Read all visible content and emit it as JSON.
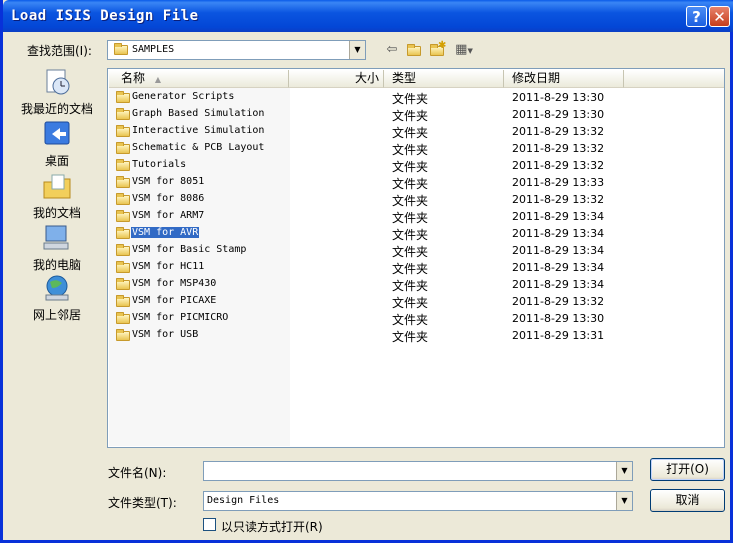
{
  "window": {
    "title": "Load ISIS Design File",
    "help_label": "?",
    "close_label": "✕"
  },
  "lookin": {
    "label": "查找范围(I):",
    "value": "SAMPLES"
  },
  "toolbar": {
    "back_icon": "back-arrow-icon",
    "up_icon": "folder-up-icon",
    "new_folder_icon": "new-folder-icon",
    "views_icon": "views-menu-icon"
  },
  "places": [
    {
      "label": "我最近的文档",
      "icon": "recent-documents-icon"
    },
    {
      "label": "桌面",
      "icon": "desktop-icon"
    },
    {
      "label": "我的文档",
      "icon": "my-documents-icon"
    },
    {
      "label": "我的电脑",
      "icon": "my-computer-icon"
    },
    {
      "label": "网上邻居",
      "icon": "network-places-icon"
    }
  ],
  "columns": {
    "name": "名称",
    "size": "大小",
    "type": "类型",
    "modified": "修改日期"
  },
  "files": [
    {
      "name": "Generator Scripts",
      "type": "文件夹",
      "modified": "2011-8-29 13:30"
    },
    {
      "name": "Graph Based Simulation",
      "type": "文件夹",
      "modified": "2011-8-29 13:30"
    },
    {
      "name": "Interactive Simulation",
      "type": "文件夹",
      "modified": "2011-8-29 13:32"
    },
    {
      "name": "Schematic & PCB Layout",
      "type": "文件夹",
      "modified": "2011-8-29 13:32"
    },
    {
      "name": "Tutorials",
      "type": "文件夹",
      "modified": "2011-8-29 13:32"
    },
    {
      "name": "VSM for 8051",
      "type": "文件夹",
      "modified": "2011-8-29 13:33"
    },
    {
      "name": "VSM for 8086",
      "type": "文件夹",
      "modified": "2011-8-29 13:32"
    },
    {
      "name": "VSM for ARM7",
      "type": "文件夹",
      "modified": "2011-8-29 13:34"
    },
    {
      "name": "VSM for AVR",
      "type": "文件夹",
      "modified": "2011-8-29 13:34",
      "selected": true
    },
    {
      "name": "VSM for Basic Stamp",
      "type": "文件夹",
      "modified": "2011-8-29 13:34"
    },
    {
      "name": "VSM for HC11",
      "type": "文件夹",
      "modified": "2011-8-29 13:34"
    },
    {
      "name": "VSM for MSP430",
      "type": "文件夹",
      "modified": "2011-8-29 13:34"
    },
    {
      "name": "VSM for PICAXE",
      "type": "文件夹",
      "modified": "2011-8-29 13:32"
    },
    {
      "name": "VSM for PICMICRO",
      "type": "文件夹",
      "modified": "2011-8-29 13:30"
    },
    {
      "name": "VSM for USB",
      "type": "文件夹",
      "modified": "2011-8-29 13:31"
    }
  ],
  "filename": {
    "label": "文件名(N):",
    "value": ""
  },
  "filetype": {
    "label": "文件类型(T):",
    "value": "Design Files"
  },
  "buttons": {
    "open": "打开(O)",
    "cancel": "取消"
  },
  "readonly": {
    "label": "以只读方式打开(R)",
    "checked": false
  }
}
